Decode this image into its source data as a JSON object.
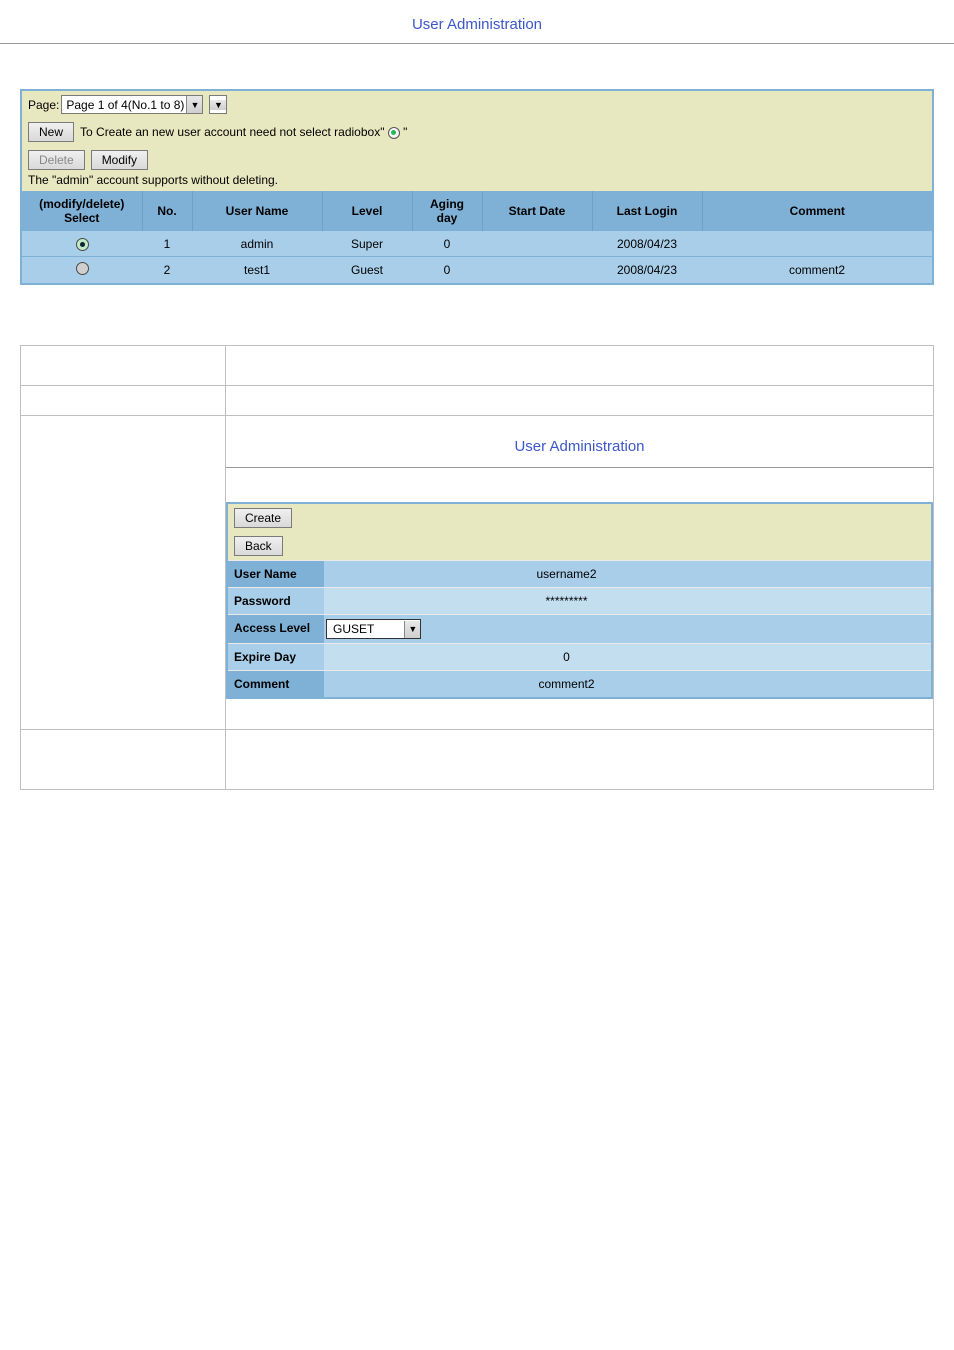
{
  "main": {
    "title": "User Administration",
    "pageLabel": "Page:",
    "pageSelectValue": "Page 1 of 4(No.1 to 8)",
    "newBtn": "New",
    "newNote": "To Create an new user account need not select radiobox\"",
    "newNoteTail": "\"",
    "deleteBtn": "Delete",
    "modifyBtn": "Modify",
    "adminNote": "The \"admin\" account supports without deleting.",
    "headers": {
      "select1": "(modify/delete)",
      "select2": "Select",
      "no": "No.",
      "userName": "User Name",
      "level": "Level",
      "aging1": "Aging",
      "aging2": "day",
      "startDate": "Start Date",
      "lastLogin": "Last Login",
      "comment": "Comment"
    },
    "rows": [
      {
        "selected": true,
        "no": "1",
        "userName": "admin",
        "level": "Super",
        "aging": "0",
        "startDate": "",
        "lastLogin": "2008/04/23",
        "comment": ""
      },
      {
        "selected": false,
        "no": "2",
        "userName": "test1",
        "level": "Guest",
        "aging": "0",
        "startDate": "",
        "lastLogin": "2008/04/23",
        "comment": "comment2"
      }
    ]
  },
  "form": {
    "title": "User Administration",
    "createBtn": "Create",
    "backBtn": "Back",
    "fields": {
      "userNameLabel": "User Name",
      "userName": "username2",
      "passwordLabel": "Password",
      "password": "*********",
      "accessLabel": "Access Level",
      "accessValue": "GUSET",
      "expireLabel": "Expire Day",
      "expire": "0",
      "commentLabel": "Comment",
      "comment": "comment2"
    }
  }
}
